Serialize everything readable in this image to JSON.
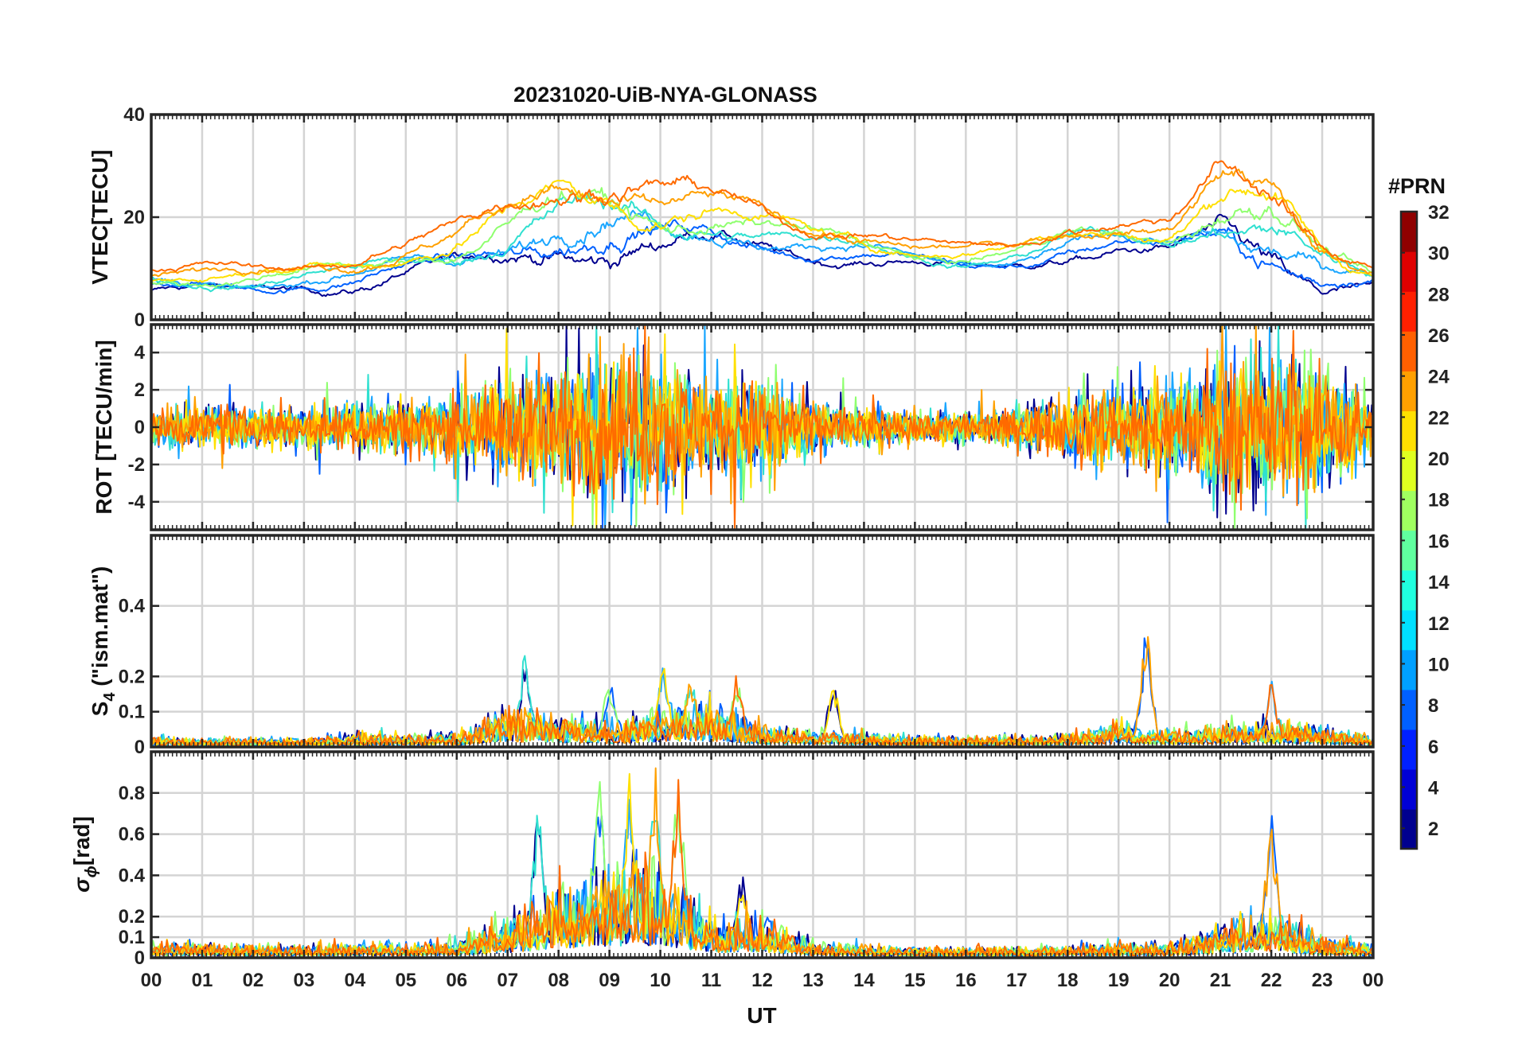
{
  "figure": {
    "title": "20231020-UiB-NYA-GLONASS",
    "xlabel": "UT",
    "colorbar_label": "#PRN",
    "colorbar_ticks": [
      "2",
      "4",
      "6",
      "8",
      "10",
      "12",
      "14",
      "16",
      "18",
      "20",
      "22",
      "24",
      "26",
      "28",
      "30",
      "32"
    ]
  },
  "chart_data": [
    {
      "type": "line",
      "panel": "vtec",
      "ylabel": "VTEC[TECU]",
      "ylim": [
        0,
        40
      ],
      "yticks": [
        "0",
        "20",
        "40"
      ],
      "xlim": [
        0,
        24
      ],
      "xtick_labels": [
        "00",
        "01",
        "02",
        "03",
        "04",
        "05",
        "06",
        "07",
        "08",
        "09",
        "10",
        "11",
        "12",
        "13",
        "14",
        "15",
        "16",
        "17",
        "18",
        "19",
        "20",
        "21",
        "22",
        "23",
        "00"
      ],
      "grid": true,
      "x": [
        0,
        1,
        2,
        3,
        4,
        5,
        6,
        7,
        8,
        9,
        10,
        11,
        12,
        13,
        14,
        15,
        16,
        17,
        18,
        19,
        20,
        21,
        22,
        23,
        24
      ],
      "envelope_center": [
        8,
        8,
        8,
        9,
        10,
        12,
        14,
        18,
        22,
        22,
        20,
        20,
        18,
        16,
        15,
        13,
        12,
        13,
        16,
        17,
        16,
        22,
        20,
        12,
        9
      ],
      "envelope_spread": [
        3,
        3,
        3,
        3,
        4,
        4,
        5,
        7,
        9,
        10,
        8,
        6,
        5,
        4,
        4,
        3,
        3,
        3,
        4,
        4,
        4,
        9,
        10,
        6,
        3
      ],
      "series_colors": [
        "#00008f",
        "#0060ff",
        "#1aa6ff",
        "#2fe0d0",
        "#8fff6f",
        "#ffe000",
        "#ffa000",
        "#ff6a00"
      ]
    },
    {
      "type": "line",
      "panel": "rot",
      "ylabel": "ROT [TECU/min]",
      "ylim": [
        -5.5,
        5.5
      ],
      "yticks": [
        "-4",
        "-2",
        "0",
        "2",
        "4"
      ],
      "xlim": [
        0,
        24
      ],
      "grid": true,
      "x": [
        0,
        1,
        2,
        3,
        4,
        5,
        6,
        7,
        8,
        9,
        10,
        11,
        12,
        13,
        14,
        15,
        16,
        17,
        18,
        19,
        20,
        21,
        22,
        23,
        24
      ],
      "amplitude_envelope": [
        1.5,
        1.5,
        1.5,
        1.5,
        1.8,
        2,
        2.5,
        3.5,
        5,
        5.5,
        5.5,
        3.5,
        4,
        2,
        1.5,
        1.2,
        1.2,
        1.5,
        2.5,
        3,
        3.5,
        5.5,
        5.5,
        5,
        2
      ],
      "series_colors": [
        "#00008f",
        "#0060ff",
        "#1aa6ff",
        "#2fe0d0",
        "#8fff6f",
        "#ffe000",
        "#ffa000",
        "#ff6a00"
      ]
    },
    {
      "type": "line",
      "panel": "s4",
      "ylabel": "S",
      "ylabel_sub": "4",
      "ylabel_rest": " (\"ism.mat\")",
      "ylim": [
        0,
        0.6
      ],
      "yticks": [
        "0",
        "0.1",
        "0.2",
        "0.4"
      ],
      "xlim": [
        0,
        24
      ],
      "grid": true,
      "x": [
        0,
        1,
        2,
        3,
        4,
        5,
        6,
        7,
        8,
        9,
        10,
        11,
        12,
        13,
        14,
        15,
        16,
        17,
        18,
        19,
        20,
        21,
        22,
        23,
        24
      ],
      "amplitude_envelope": [
        0.05,
        0.04,
        0.04,
        0.04,
        0.06,
        0.06,
        0.06,
        0.18,
        0.15,
        0.12,
        0.18,
        0.2,
        0.1,
        0.08,
        0.06,
        0.05,
        0.05,
        0.05,
        0.06,
        0.12,
        0.08,
        0.1,
        0.12,
        0.1,
        0.05
      ],
      "peaks": [
        [
          7.35,
          0.3
        ],
        [
          9.0,
          0.22
        ],
        [
          10.05,
          0.27
        ],
        [
          10.6,
          0.22
        ],
        [
          11.5,
          0.23
        ],
        [
          13.4,
          0.2
        ],
        [
          19.55,
          0.37
        ],
        [
          22.0,
          0.2
        ]
      ],
      "series_colors": [
        "#00008f",
        "#0060ff",
        "#1aa6ff",
        "#2fe0d0",
        "#8fff6f",
        "#ffe000",
        "#ffa000",
        "#ff6a00"
      ]
    },
    {
      "type": "line",
      "panel": "sigma_phi",
      "ylabel": "σ",
      "ylabel_sub": "ϕ",
      "ylabel_rest": "[rad]",
      "ylim": [
        0,
        1
      ],
      "yticks": [
        "0",
        "0.1",
        "0.2",
        "0.4",
        "0.6",
        "0.8"
      ],
      "xlim": [
        0,
        24
      ],
      "grid": true,
      "x": [
        0,
        1,
        2,
        3,
        4,
        5,
        6,
        7,
        8,
        9,
        10,
        11,
        12,
        13,
        14,
        15,
        16,
        17,
        18,
        19,
        20,
        21,
        22,
        23,
        24
      ],
      "amplitude_envelope": [
        0.12,
        0.12,
        0.1,
        0.1,
        0.12,
        0.12,
        0.14,
        0.3,
        0.55,
        0.7,
        0.75,
        0.3,
        0.35,
        0.12,
        0.1,
        0.08,
        0.08,
        0.08,
        0.1,
        0.12,
        0.12,
        0.25,
        0.4,
        0.15,
        0.1
      ],
      "peaks": [
        [
          7.6,
          0.78
        ],
        [
          8.8,
          1.0
        ],
        [
          9.4,
          1.0
        ],
        [
          9.9,
          1.0
        ],
        [
          10.35,
          1.0
        ],
        [
          11.6,
          0.46
        ],
        [
          22.0,
          0.76
        ]
      ],
      "series_colors": [
        "#00008f",
        "#0060ff",
        "#1aa6ff",
        "#2fe0d0",
        "#8fff6f",
        "#ffe000",
        "#ffa000",
        "#ff6a00"
      ]
    }
  ]
}
